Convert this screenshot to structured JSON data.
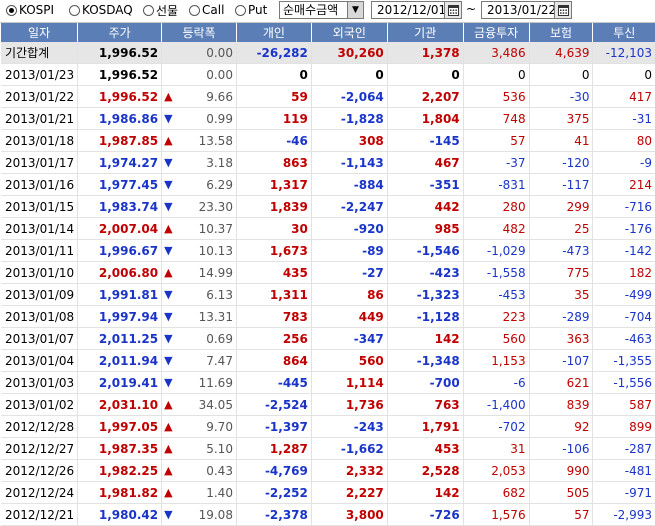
{
  "toolbar": {
    "radios": [
      {
        "label": "KOSPI",
        "selected": true
      },
      {
        "label": "KOSDAQ",
        "selected": false
      },
      {
        "label": "선물",
        "selected": false
      },
      {
        "label": "Call",
        "selected": false
      },
      {
        "label": "Put",
        "selected": false
      }
    ],
    "select_value": "순매수금액",
    "date_from": "2012/12/01",
    "date_sep": "~",
    "date_to": "2013/01/22"
  },
  "columns": [
    "일자",
    "주가",
    "등락폭",
    "개인",
    "외국인",
    "기관",
    "금융투자",
    "보험",
    "투신"
  ],
  "colors": {
    "header_bg": "#5b7eb7",
    "up": "#c00000",
    "down": "#1a34c8"
  },
  "summary": {
    "date": "기간합계",
    "price": "1,996.52",
    "change": "0.00",
    "dir": "",
    "indiv": "-26,282",
    "foreign": "30,260",
    "inst": "1,378",
    "fin": "3,486",
    "ins": "4,639",
    "trust": "-12,103"
  },
  "rows": [
    {
      "date": "2013/01/23",
      "price": "1,996.52",
      "change": "0.00",
      "dir": "",
      "indiv": "0",
      "foreign": "0",
      "inst": "0",
      "fin": "0",
      "ins": "0",
      "trust": "0"
    },
    {
      "date": "2013/01/22",
      "price": "1,996.52",
      "change": "9.66",
      "dir": "up",
      "indiv": "59",
      "foreign": "-2,064",
      "inst": "2,207",
      "fin": "536",
      "ins": "-30",
      "trust": "417"
    },
    {
      "date": "2013/01/21",
      "price": "1,986.86",
      "change": "0.99",
      "dir": "down",
      "indiv": "119",
      "foreign": "-1,828",
      "inst": "1,804",
      "fin": "748",
      "ins": "375",
      "trust": "-31"
    },
    {
      "date": "2013/01/18",
      "price": "1,987.85",
      "change": "13.58",
      "dir": "up",
      "indiv": "-46",
      "foreign": "308",
      "inst": "-145",
      "fin": "57",
      "ins": "41",
      "trust": "80"
    },
    {
      "date": "2013/01/17",
      "price": "1,974.27",
      "change": "3.18",
      "dir": "down",
      "indiv": "863",
      "foreign": "-1,143",
      "inst": "467",
      "fin": "-37",
      "ins": "-120",
      "trust": "-9"
    },
    {
      "date": "2013/01/16",
      "price": "1,977.45",
      "change": "6.29",
      "dir": "down",
      "indiv": "1,317",
      "foreign": "-884",
      "inst": "-351",
      "fin": "-831",
      "ins": "-117",
      "trust": "214"
    },
    {
      "date": "2013/01/15",
      "price": "1,983.74",
      "change": "23.30",
      "dir": "down",
      "indiv": "1,839",
      "foreign": "-2,247",
      "inst": "442",
      "fin": "280",
      "ins": "299",
      "trust": "-716"
    },
    {
      "date": "2013/01/14",
      "price": "2,007.04",
      "change": "10.37",
      "dir": "up",
      "indiv": "30",
      "foreign": "-920",
      "inst": "985",
      "fin": "482",
      "ins": "25",
      "trust": "-176"
    },
    {
      "date": "2013/01/11",
      "price": "1,996.67",
      "change": "10.13",
      "dir": "down",
      "indiv": "1,673",
      "foreign": "-89",
      "inst": "-1,546",
      "fin": "-1,029",
      "ins": "-473",
      "trust": "-142"
    },
    {
      "date": "2013/01/10",
      "price": "2,006.80",
      "change": "14.99",
      "dir": "up",
      "indiv": "435",
      "foreign": "-27",
      "inst": "-423",
      "fin": "-1,558",
      "ins": "775",
      "trust": "182"
    },
    {
      "date": "2013/01/09",
      "price": "1,991.81",
      "change": "6.13",
      "dir": "down",
      "indiv": "1,311",
      "foreign": "86",
      "inst": "-1,323",
      "fin": "-453",
      "ins": "35",
      "trust": "-499"
    },
    {
      "date": "2013/01/08",
      "price": "1,997.94",
      "change": "13.31",
      "dir": "down",
      "indiv": "783",
      "foreign": "449",
      "inst": "-1,128",
      "fin": "223",
      "ins": "-289",
      "trust": "-704"
    },
    {
      "date": "2013/01/07",
      "price": "2,011.25",
      "change": "0.69",
      "dir": "down",
      "indiv": "256",
      "foreign": "-347",
      "inst": "142",
      "fin": "560",
      "ins": "363",
      "trust": "-463"
    },
    {
      "date": "2013/01/04",
      "price": "2,011.94",
      "change": "7.47",
      "dir": "down",
      "indiv": "864",
      "foreign": "560",
      "inst": "-1,348",
      "fin": "1,153",
      "ins": "-107",
      "trust": "-1,355"
    },
    {
      "date": "2013/01/03",
      "price": "2,019.41",
      "change": "11.69",
      "dir": "down",
      "indiv": "-445",
      "foreign": "1,114",
      "inst": "-700",
      "fin": "-6",
      "ins": "621",
      "trust": "-1,556"
    },
    {
      "date": "2013/01/02",
      "price": "2,031.10",
      "change": "34.05",
      "dir": "up",
      "indiv": "-2,524",
      "foreign": "1,736",
      "inst": "763",
      "fin": "-1,400",
      "ins": "839",
      "trust": "587"
    },
    {
      "date": "2012/12/28",
      "price": "1,997.05",
      "change": "9.70",
      "dir": "up",
      "indiv": "-1,397",
      "foreign": "-243",
      "inst": "1,791",
      "fin": "-702",
      "ins": "92",
      "trust": "899"
    },
    {
      "date": "2012/12/27",
      "price": "1,987.35",
      "change": "5.10",
      "dir": "up",
      "indiv": "1,287",
      "foreign": "-1,662",
      "inst": "453",
      "fin": "31",
      "ins": "-106",
      "trust": "-287"
    },
    {
      "date": "2012/12/26",
      "price": "1,982.25",
      "change": "0.43",
      "dir": "up",
      "indiv": "-4,769",
      "foreign": "2,332",
      "inst": "2,528",
      "fin": "2,053",
      "ins": "990",
      "trust": "-481"
    },
    {
      "date": "2012/12/24",
      "price": "1,981.82",
      "change": "1.40",
      "dir": "up",
      "indiv": "-2,252",
      "foreign": "2,227",
      "inst": "142",
      "fin": "682",
      "ins": "505",
      "trust": "-971"
    },
    {
      "date": "2012/12/21",
      "price": "1,980.42",
      "change": "19.08",
      "dir": "down",
      "indiv": "-2,378",
      "foreign": "3,800",
      "inst": "-726",
      "fin": "1,576",
      "ins": "57",
      "trust": "-2,993"
    }
  ]
}
